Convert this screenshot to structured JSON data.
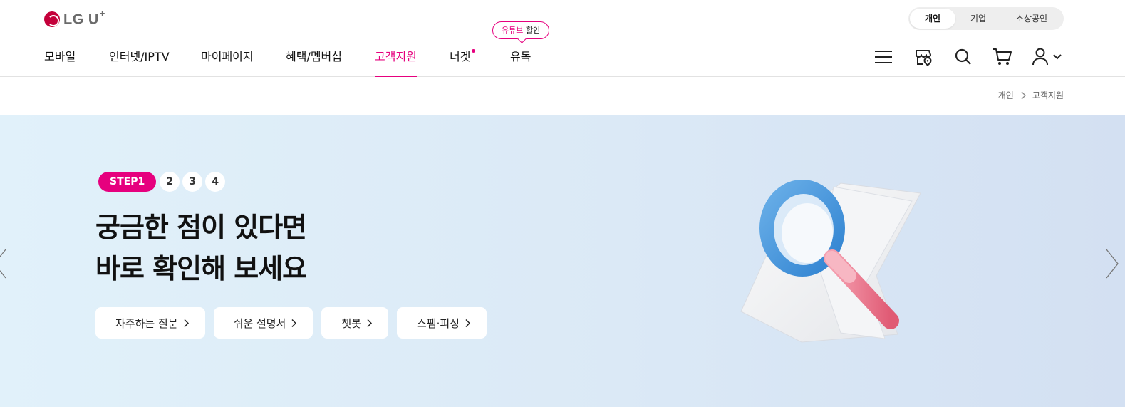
{
  "brand": {
    "logo_text": "LG U",
    "logo_superscript": "+"
  },
  "segments": [
    {
      "label": "개인",
      "active": true
    },
    {
      "label": "기업",
      "active": false
    },
    {
      "label": "소상공인",
      "active": false
    }
  ],
  "nav": {
    "items": [
      {
        "label": "모바일",
        "active": false
      },
      {
        "label": "인터넷/IPTV",
        "active": false
      },
      {
        "label": "마이페이지",
        "active": false
      },
      {
        "label": "혜택/멤버십",
        "active": false
      },
      {
        "label": "고객지원",
        "active": true
      },
      {
        "label": "너겟",
        "active": false,
        "has_dot": true
      },
      {
        "label": "유독",
        "active": false
      }
    ],
    "promo": {
      "highlight": "유튜브",
      "text": " 할인"
    },
    "util_icons": [
      "menu-icon",
      "store-location-icon",
      "search-icon",
      "cart-icon",
      "user-icon"
    ]
  },
  "breadcrumb": {
    "items": [
      "개인",
      "고객지원"
    ]
  },
  "hero": {
    "steps": {
      "active": "STEP1",
      "others": [
        "2",
        "3",
        "4"
      ]
    },
    "title_lines": [
      "궁금한 점이 있다면",
      "바로 확인해 보세요"
    ],
    "buttons": [
      "자주하는 질문",
      "쉬운 설명서",
      "챗봇",
      "스팸·피싱"
    ]
  },
  "colors": {
    "accent": "#e6007e",
    "brand_red": "#c4003a",
    "hero_bg": "#dbe9f6"
  }
}
